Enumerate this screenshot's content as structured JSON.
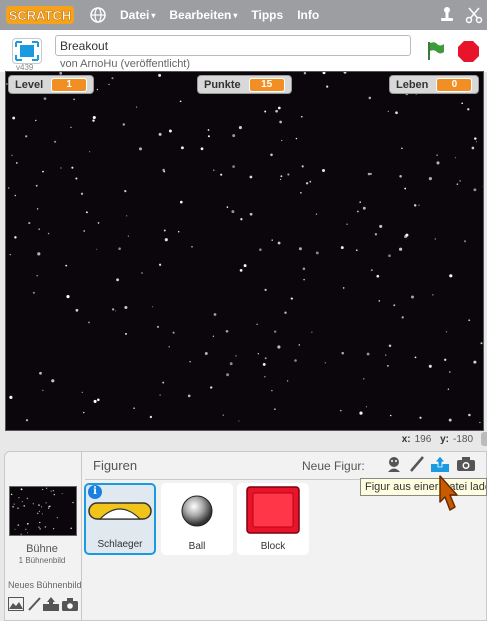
{
  "menubar": {
    "logo_text": "SCRATCH",
    "menus": [
      {
        "label": "Datei",
        "has_caret": true
      },
      {
        "label": "Bearbeiten",
        "has_caret": true
      },
      {
        "label": "Tipps",
        "has_caret": false
      },
      {
        "label": "Info",
        "has_caret": false
      }
    ],
    "caret": "▾",
    "right_icons": [
      "stamp-icon",
      "scissors-icon"
    ]
  },
  "project": {
    "title": "Breakout",
    "byline": "von ArnoHu (veröffentlicht)",
    "version": "v439"
  },
  "stage": {
    "monitors": [
      {
        "label": "Level",
        "value": "1"
      },
      {
        "label": "Punkte",
        "value": "15"
      },
      {
        "label": "Leben",
        "value": "0"
      }
    ]
  },
  "coords": {
    "x_label": "x:",
    "x": "196",
    "y_label": "y:",
    "y": "-180"
  },
  "sprites_pane": {
    "title": "Figuren",
    "new_sprite_label": "Neue Figur:",
    "new_sprite_icons": [
      "sprite-library-icon",
      "paint-icon",
      "upload-icon",
      "camera-icon"
    ],
    "tooltip": "Figur aus einer Datei laden",
    "sprites": [
      {
        "name": "Schlaeger",
        "selected": true
      },
      {
        "name": "Ball",
        "selected": false
      },
      {
        "name": "Block",
        "selected": false
      }
    ]
  },
  "stage_panel": {
    "label": "Bühne",
    "backdrops": "1 Bühnenbild",
    "new_backdrop_label": "Neues Bühnenbild:",
    "icons": [
      "image-icon",
      "brush-icon",
      "upload-icon",
      "camera-icon"
    ]
  },
  "colors": {
    "menubar": "#9c9ea2",
    "accent_blue": "#1a9be0",
    "monitor_value": "#f28f24",
    "stop": "#e8142a",
    "flag": "#3d9b3d"
  }
}
